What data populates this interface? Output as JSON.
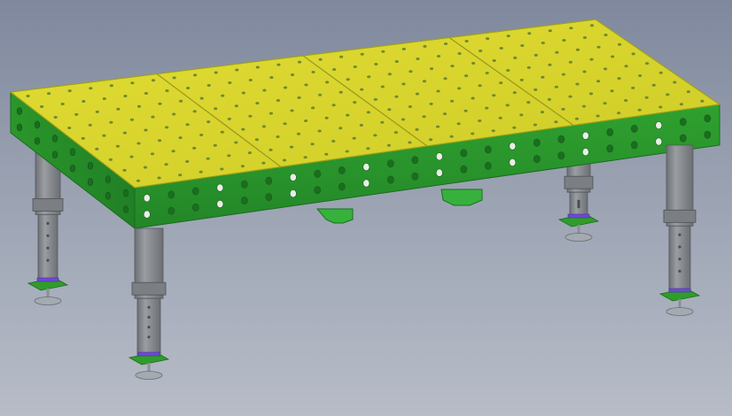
{
  "scene": {
    "colors": {
      "background_top": "#7f889d",
      "background_bottom": "#b7bcc7",
      "tabletop": "#d9d52f",
      "tabletop_edge": "#b8b71f",
      "hole_on_yellow": "#6f8b2f",
      "frame_green": "#2c9a2c",
      "frame_green_dark": "#1f7a22",
      "hole_on_green": "#e8efe8",
      "leg_gray": "#8a8d92",
      "leg_gray_dark": "#62656a",
      "foot_plate_green": "#2f9d2a",
      "foot_accent_purple": "#6c4bd1",
      "foot_gray": "#9aa0a7"
    },
    "icons": {
      "model": "welding-table-3d-model"
    }
  }
}
